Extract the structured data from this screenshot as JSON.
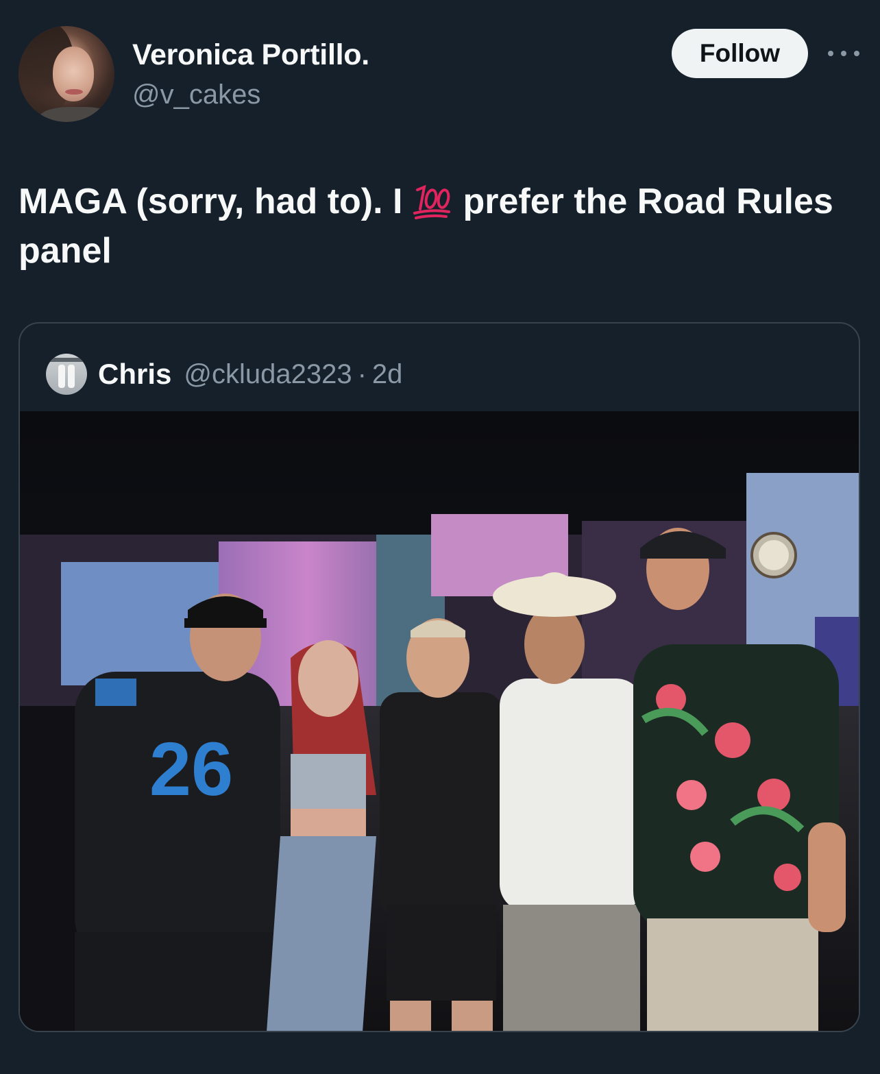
{
  "author": {
    "display_name": "Veronica Portillo.",
    "handle": "@v_cakes"
  },
  "follow_label": "Follow",
  "tweet": {
    "text_before_emoji": "MAGA (sorry, had to).  I",
    "emoji": "hundred-points-emoji",
    "text_after_emoji": "prefer the Road Rules panel"
  },
  "quoted": {
    "display_name": "Chris",
    "handle": "@ckluda2323",
    "separator": "·",
    "time": "2d",
    "photo": {
      "jersey_number": "26"
    }
  },
  "colors": {
    "background": "#15202b",
    "text_primary": "#f7f9f9",
    "text_secondary": "#8b98a5",
    "border": "#38444d",
    "follow_bg": "#eff3f4"
  }
}
